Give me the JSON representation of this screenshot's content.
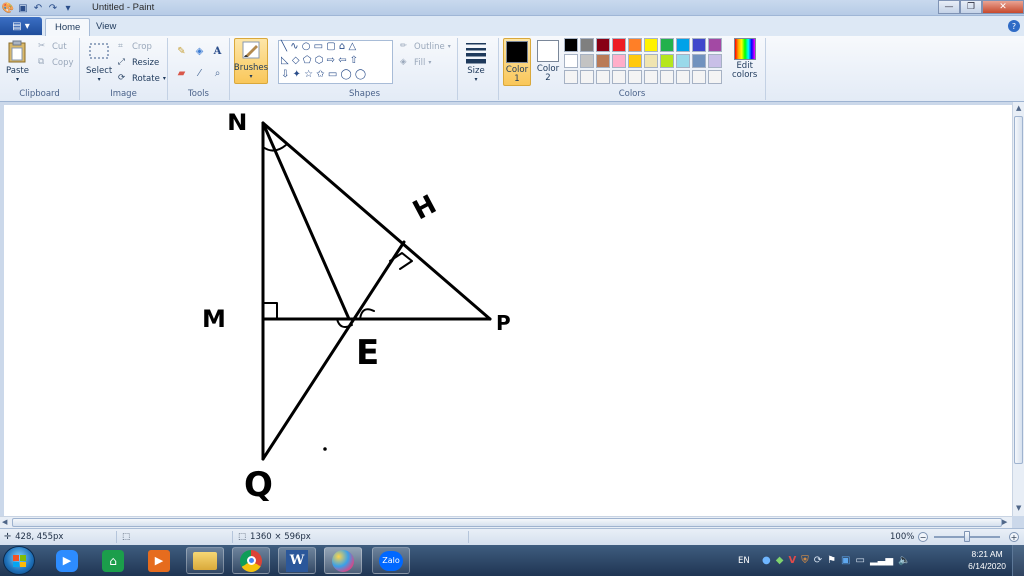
{
  "window": {
    "title": "Untitled - Paint"
  },
  "tabs": [
    {
      "label": "Home"
    },
    {
      "label": "View"
    }
  ],
  "ribbon": {
    "clipboard": {
      "group_label": "Clipboard",
      "paste": "Paste",
      "cut": "Cut",
      "copy": "Copy"
    },
    "image": {
      "group_label": "Image",
      "select": "Select",
      "crop": "Crop",
      "resize": "Resize",
      "rotate": "Rotate"
    },
    "tools": {
      "group_label": "Tools"
    },
    "brushes": {
      "label": "Brushes"
    },
    "shapes": {
      "group_label": "Shapes",
      "outline": "Outline",
      "fill": "Fill"
    },
    "size": {
      "label": "Size"
    },
    "colors": {
      "group_label": "Colors",
      "color1_label": "Color",
      "color1_num": "1",
      "color2_label": "Color",
      "color2_num": "2",
      "edit_label_1": "Edit",
      "edit_label_2": "colors",
      "color1": "#000000",
      "color2": "#ffffff",
      "palette": [
        "#000000",
        "#7f7f7f",
        "#880015",
        "#ed1c24",
        "#ff7f27",
        "#fff200",
        "#22b14c",
        "#00a2e8",
        "#3f48cc",
        "#a349a4",
        "#ffffff",
        "#c3c3c3",
        "#b97a57",
        "#ffaec9",
        "#ffc90e",
        "#efe4b0",
        "#b5e61d",
        "#99d9ea",
        "#7092be",
        "#c8bfe7",
        "#f4f4f4",
        "#f4f4f4",
        "#f4f4f4",
        "#f4f4f4",
        "#f4f4f4",
        "#f4f4f4",
        "#f4f4f4",
        "#f4f4f4",
        "#f4f4f4",
        "#f4f4f4"
      ]
    }
  },
  "drawing": {
    "labels": {
      "N": "N",
      "M": "M",
      "P": "P",
      "E": "E",
      "H": "H",
      "Q": "Q"
    }
  },
  "status": {
    "cursor_pos": "428, 455px",
    "image_size": "1360 × 596px",
    "zoom": "100%"
  },
  "taskbar": {
    "apps": [
      "Zoom",
      "Maps",
      "Media Player",
      "File Explorer",
      "Chrome",
      "Word",
      "Paint",
      "Zalo"
    ],
    "zalo_label": "Zalo",
    "language": "EN",
    "time": "8:21 AM",
    "date": "6/14/2020"
  }
}
